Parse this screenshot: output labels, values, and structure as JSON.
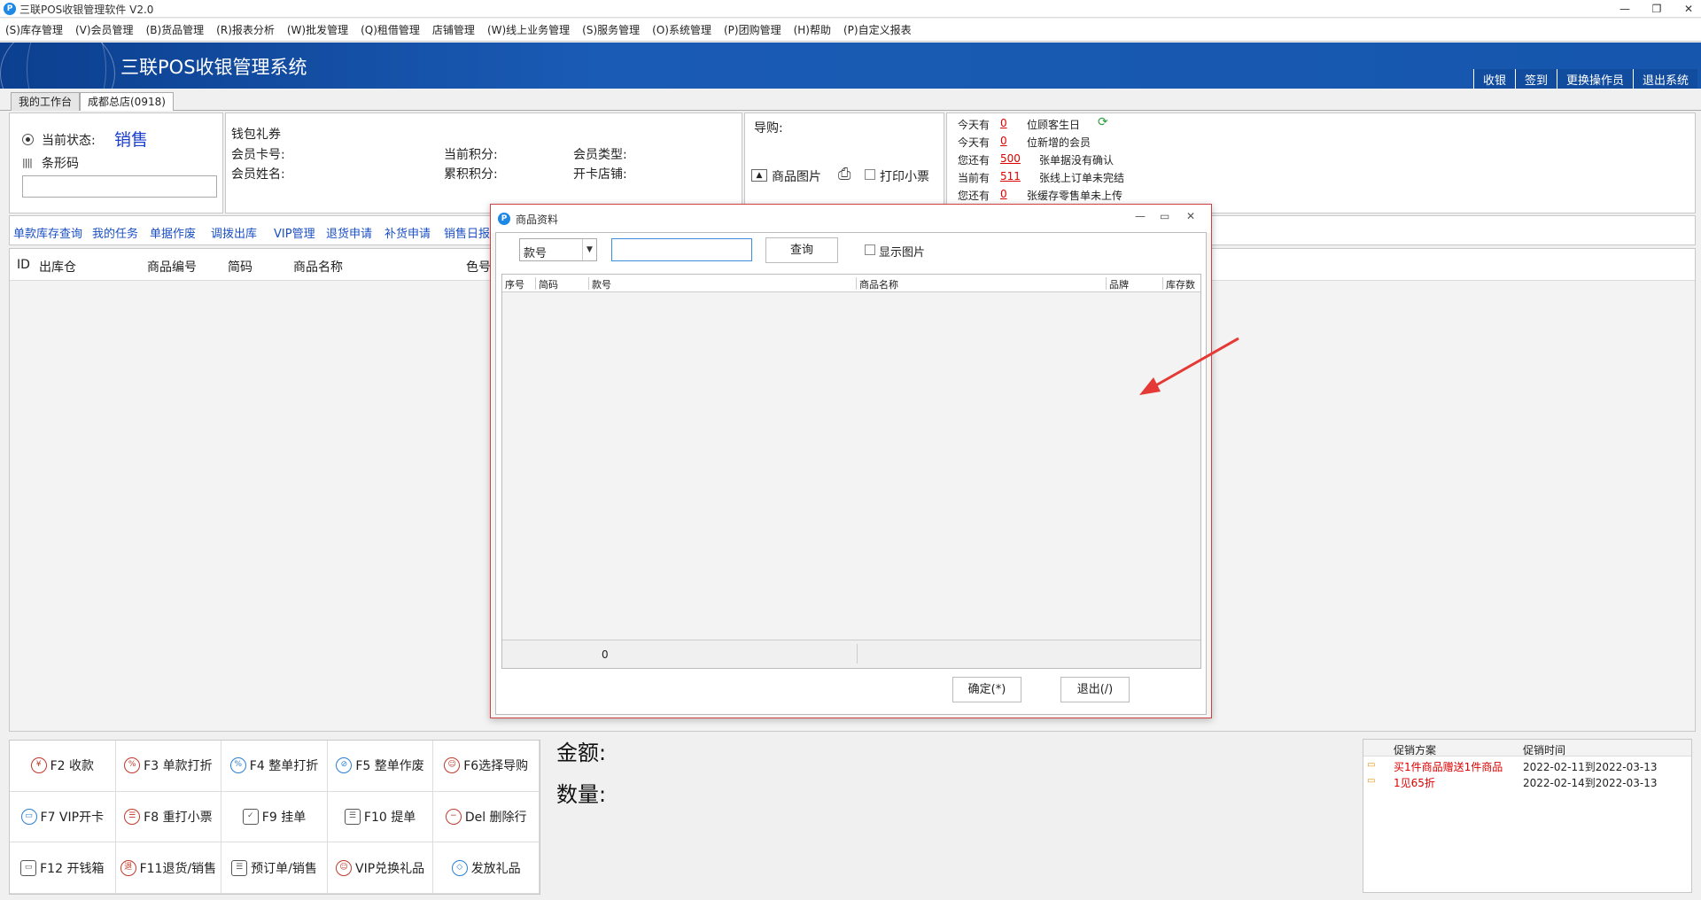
{
  "window": {
    "title": "三联POS收银管理软件 V2.0",
    "app_icon": "P"
  },
  "menu": [
    "(S)库存管理",
    "(V)会员管理",
    "(B)货品管理",
    "(R)报表分析",
    "(W)批发管理",
    "(Q)租借管理",
    "店铺管理",
    "(W)线上业务管理",
    "(S)服务管理",
    "(O)系统管理",
    "(P)团购管理",
    "(H)帮助",
    "(P)自定义报表"
  ],
  "banner": {
    "title": "三联POS收银管理系统",
    "links": [
      "收银",
      "签到",
      "更换操作员",
      "退出系统"
    ]
  },
  "tabs": [
    "我的工作台",
    "成都总店(0918)"
  ],
  "status": {
    "label": "当前状态:",
    "value": "销售",
    "barcode_label": "条形码",
    "barcode_value": ""
  },
  "member": {
    "wallet": "钱包礼券",
    "card_no": "会员卡号:",
    "name": "会员姓名:",
    "cur_points": "当前积分:",
    "acc_points": "累积积分:",
    "type": "会员类型:",
    "shop": "开卡店铺:"
  },
  "guide": {
    "label": "导购:",
    "img_label": "商品图片",
    "print_label": "打印小票"
  },
  "notices": [
    {
      "pre": "今天有",
      "num": "0",
      "post": "位顾客生日"
    },
    {
      "pre": "今天有",
      "num": "0",
      "post": "位新增的会员"
    },
    {
      "pre": "您还有",
      "num": "500",
      "post": "张单据没有确认"
    },
    {
      "pre": "当前有",
      "num": "511",
      "post": "张线上订单未完结"
    },
    {
      "pre": "您还有",
      "num": "0",
      "post": "张缓存零售单未上传"
    }
  ],
  "quick_links": [
    "单款库存查询",
    "我的任务",
    "单据作废",
    "调拨出库",
    "VIP管理",
    "退货申请",
    "补货申请",
    "销售日报"
  ],
  "grid_headers": [
    "ID",
    "出库仓",
    "商品编号",
    "简码",
    "商品名称",
    "色号"
  ],
  "fkeys": [
    {
      "icon": "¥",
      "label": "F2 收款"
    },
    {
      "icon": "%",
      "label": "F3 单款打折"
    },
    {
      "icon": "%",
      "label": "F4 整单打折"
    },
    {
      "icon": "⊘",
      "label": "F5 整单作废"
    },
    {
      "icon": "☺",
      "label": "F6选择导购"
    },
    {
      "icon": "▭",
      "label": "F7 VIP开卡"
    },
    {
      "icon": "☰",
      "label": "F8 重打小票"
    },
    {
      "icon": "✓",
      "label": "F9 挂单"
    },
    {
      "icon": "☰",
      "label": "F10 提单"
    },
    {
      "icon": "−",
      "label": "Del 删除行"
    },
    {
      "icon": "▭",
      "label": "F12 开钱箱"
    },
    {
      "icon": "退",
      "label": "F11退货/销售"
    },
    {
      "icon": "☰",
      "label": "预订单/销售"
    },
    {
      "icon": "☺",
      "label": "VIP兑换礼品"
    },
    {
      "icon": "◇",
      "label": "发放礼品"
    }
  ],
  "totals": {
    "amount": "金额:",
    "qty": "数量:"
  },
  "promo": {
    "headers": [
      "促销方案",
      "促销时间"
    ],
    "rows": [
      {
        "name": "买1件商品赠送1件商品",
        "time": "2022-02-11到2022-03-13"
      },
      {
        "name": "1见65折",
        "time": "2022-02-14到2022-03-13"
      }
    ]
  },
  "dialog": {
    "title": "商品资料",
    "combo_value": "款号",
    "search_value": "",
    "query_label": "查询",
    "show_img_label": "显示图片",
    "columns": [
      "序号",
      "简码",
      "款号",
      "商品名称",
      "品牌",
      "库存数"
    ],
    "footer_count": "0",
    "ok_label": "确定(*)",
    "exit_label": "退出(/)"
  }
}
